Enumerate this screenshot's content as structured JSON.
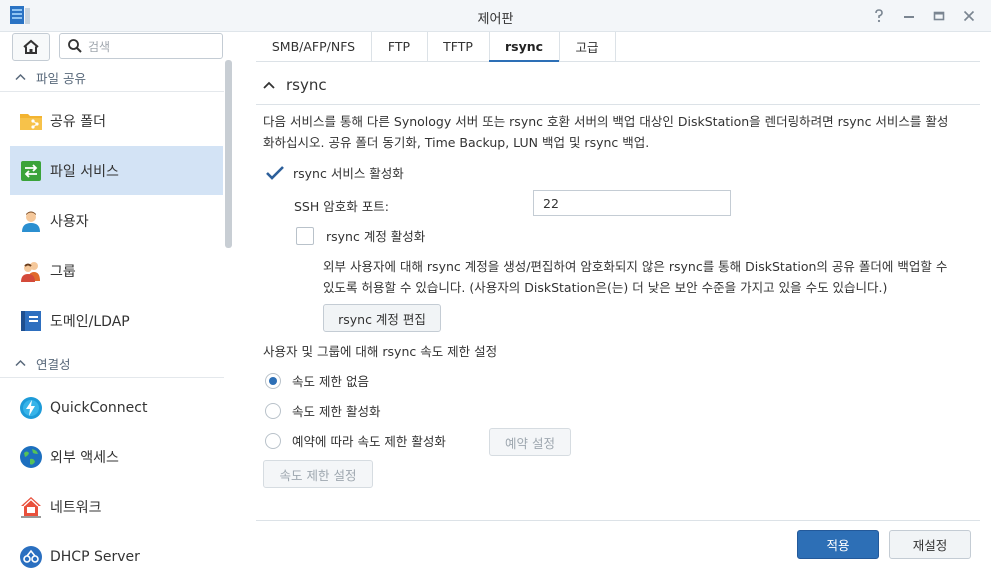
{
  "window": {
    "title": "제어판"
  },
  "sidebar": {
    "search_placeholder": "검색",
    "sections": [
      {
        "label": "파일 공유"
      },
      {
        "label": "연결성"
      }
    ],
    "items": [
      {
        "label": "공유 폴더",
        "icon": "shared-folder-icon"
      },
      {
        "label": "파일 서비스",
        "icon": "file-services-icon",
        "active": true
      },
      {
        "label": "사용자",
        "icon": "user-icon"
      },
      {
        "label": "그룹",
        "icon": "group-icon"
      },
      {
        "label": "도메인/LDAP",
        "icon": "domain-ldap-icon"
      },
      {
        "label": "QuickConnect",
        "icon": "quickconnect-icon"
      },
      {
        "label": "외부 액세스",
        "icon": "external-access-icon"
      },
      {
        "label": "네트워크",
        "icon": "network-icon"
      },
      {
        "label": "DHCP Server",
        "icon": "dhcp-server-icon"
      }
    ]
  },
  "tabs": [
    {
      "label": "SMB/AFP/NFS"
    },
    {
      "label": "FTP"
    },
    {
      "label": "TFTP"
    },
    {
      "label": "rsync",
      "active": true
    },
    {
      "label": "고급"
    }
  ],
  "rsync": {
    "section_title": "rsync",
    "description_line1": "다음 서비스를 통해 다른 Synology 서버 또는 rsync 호환 서버의 백업 대상인 DiskStation을 렌더링하려면 rsync 서비스를 활성",
    "description_line2": "화하십시오. 공유 폴더 동기화, Time Backup, LUN 백업 및 rsync 백업.",
    "enable_service_label": "rsync 서비스 활성화",
    "enable_service_checked": true,
    "ssh_port_label": "SSH 암호화 포트:",
    "ssh_port_value": "22",
    "enable_account_label": "rsync 계정 활성화",
    "enable_account_checked": false,
    "account_desc_line1": "외부 사용자에 대해 rsync 계정을 생성/편집하여 암호화되지 않은 rsync를 통해 DiskStation의 공유 폴더에 백업할 수",
    "account_desc_line2": "있도록 허용할 수 있습니다. (사용자의 DiskStation은(는) 더 낮은 보안 수준을 가지고 있을 수도 있습니다.)",
    "edit_account_button": "rsync 계정 편집",
    "speed_limit_heading": "사용자 및 그룹에 대해 rsync 속도 제한 설정",
    "speed_options": [
      {
        "label": "속도 제한 없음",
        "selected": true
      },
      {
        "label": "속도 제한 활성화",
        "selected": false
      },
      {
        "label": "예약에 따라 속도 제한 활성화",
        "selected": false
      }
    ],
    "schedule_button": "예약 설정",
    "speed_settings_button": "속도 제한 설정"
  },
  "footer": {
    "apply_button": "적용",
    "reset_button": "재설정"
  },
  "colors": {
    "accent": "#2d6fb6",
    "sidebar_active": "#d3e3f5"
  }
}
